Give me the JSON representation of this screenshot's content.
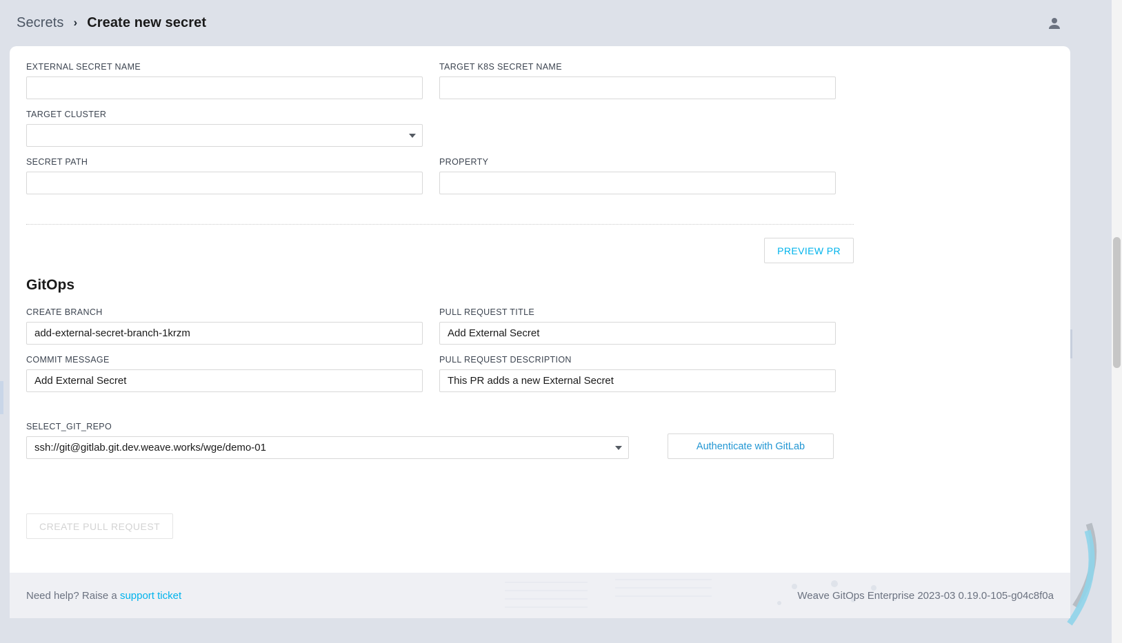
{
  "header": {
    "breadcrumb_parent": "Secrets",
    "breadcrumb_separator": "›",
    "breadcrumb_current": "Create new secret",
    "avatar_icon": "person-icon"
  },
  "form": {
    "fields": {
      "external_secret_name": {
        "label": "EXTERNAL SECRET NAME",
        "value": "",
        "placeholder": ""
      },
      "target_k8s_secret_name": {
        "label": "TARGET K8s SECRET NAME",
        "value": "",
        "placeholder": ""
      },
      "target_cluster": {
        "label": "TARGET CLUSTER",
        "value": "",
        "placeholder": ""
      },
      "secret_path": {
        "label": "SECRET PATH",
        "value": "",
        "placeholder": ""
      },
      "property": {
        "label": "PROPERTY",
        "value": "",
        "placeholder": ""
      }
    },
    "preview_pr_label": "PREVIEW PR"
  },
  "gitops": {
    "section_title": "GitOps",
    "fields": {
      "create_branch": {
        "label": "CREATE BRANCH",
        "value": "add-external-secret-branch-1krzm"
      },
      "pull_request_title": {
        "label": "PULL REQUEST TITLE",
        "value": "Add External Secret"
      },
      "commit_message": {
        "label": "COMMIT MESSAGE",
        "value": "Add External Secret"
      },
      "pull_request_description": {
        "label": "PULL REQUEST DESCRIPTION",
        "value": "This PR adds a new External Secret"
      },
      "select_git_repo": {
        "label": "SELECT_GIT_REPO",
        "value": "ssh://git@gitlab.git.dev.weave.works/wge/demo-01"
      }
    },
    "authenticate_label": "Authenticate with GitLab",
    "submit_label": "CREATE PULL REQUEST"
  },
  "footer": {
    "help_prefix": "Need help? Raise a ",
    "help_link": "support ticket",
    "version": "Weave GitOps Enterprise 2023-03 0.19.0-105-g04c8f0a"
  },
  "colors": {
    "accent": "#00b3ec",
    "link": "#2196d3",
    "page_bg": "#dde1e9",
    "card_bg": "#ffffff",
    "footer_bg": "#eff0f4",
    "disabled_text": "#d3d3d3"
  }
}
